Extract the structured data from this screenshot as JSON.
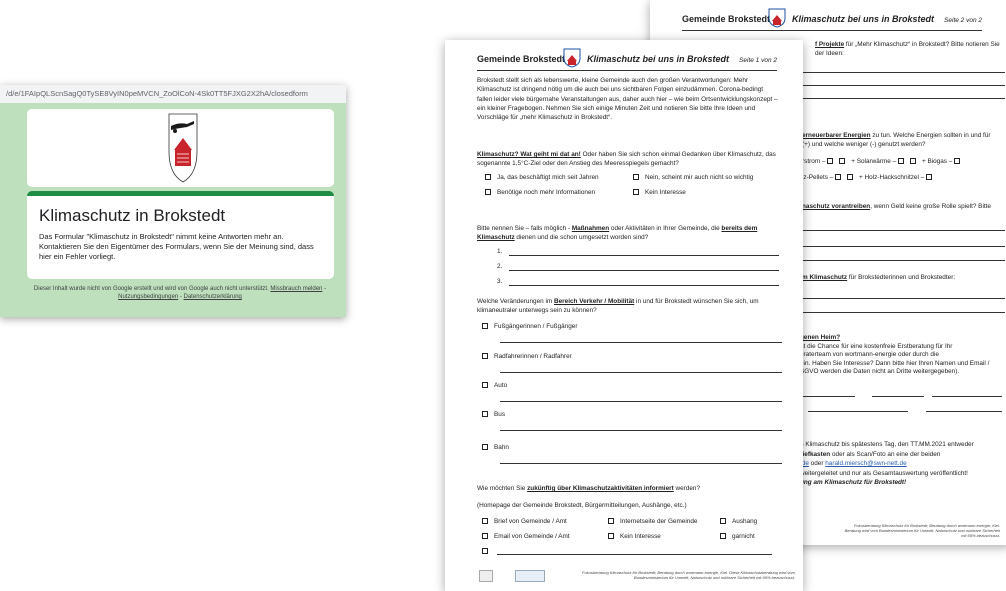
{
  "gform": {
    "url": "/d/e/1FAIpQLScnSagQ0TySE8VyIN0peMVCN_ZoOlCoN-4Sk0TT5FJXG2X2hA/closedform",
    "title": "Klimaschutz in Brokstedt",
    "message": "Das Formular \"Klimaschutz in Brokstedt\" nimmt keine Antworten mehr an. Kontaktieren Sie den Eigentümer des Formulars, wenn Sie der Meinung sind, dass hier ein Fehler vorliegt.",
    "footer_text": "Dieser Inhalt wurde nicht von Google erstellt und wird von Google auch nicht unterstützt.",
    "footer_links": [
      "Missbrauch melden",
      "Nutzungsbedingungen",
      "Datenschutzerklärung"
    ]
  },
  "doc": {
    "municipality": "Gemeinde Brokstedt",
    "subtitle": "Klimaschutz bei uns in Brokstedt",
    "page1_label": "Seite 1 von 2",
    "page2_label": "Seite 2 von 2"
  },
  "page1": {
    "intro": "Brokstedt stellt sich als lebenswerte, kleine Gemeinde auch den großen Verantwortungen: Mehr Klimaschutz ist dringend nötig um die auch bei uns sichtbaren Folgen einzudämmen. Corona-bedingt fallen leider viele bürgernahe Veranstaltungen aus, daher auch hier – wie beim Ortsentwicklungskonzept – ein kleiner Fragebogen. Nehmen Sie sich einige Minuten Zeit und notieren Sie bitte Ihre Ideen und Vorschläge für „mehr Klimaschutz in Brokstedt“.",
    "q1_head": "Klimaschutz? Wat geiht mi dat an!",
    "q1_rest": " Oder haben Sie sich schon einmal Gedanken über Klimaschutz, das sogenannte 1,5°C-Ziel oder den Anstieg des Meeresspiegels gemacht?",
    "q1_options": [
      "Ja, das beschäftigt mich seit Jahren",
      "Nein, scheint mir auch nicht so wichtig",
      "Benötige noch mehr Informationen",
      "Kein Interesse"
    ],
    "q2_a": "Bitte nennen Sie – falls möglich - ",
    "q2_b": "Maßnahmen",
    "q2_c": " oder Aktivitäten in Ihrer Gemeinde, die ",
    "q2_d": "bereits dem Klimaschutz",
    "q2_e": " dienen und die schon umgesetzt worden sind?",
    "q2_numbers": [
      "1.",
      "2.",
      "3."
    ],
    "q3_a": "Welche Veränderungen im ",
    "q3_b": "Bereich Verkehr / Mobilität",
    "q3_c": " in und für Brokstedt wünschen Sie sich, um klimaneutraler unterwegs sein zu können?",
    "q3_options": [
      "Fußgängerinnen / Fußgänger",
      "Radfahrerinnen / Radfahrer",
      "Auto",
      "Bus",
      "Bahn"
    ],
    "q4_a": "Wie möchten Sie ",
    "q4_b": "zukünftig über Klimaschutzaktivitäten informiert",
    "q4_c": " werden?",
    "q4_sub": "(Homepage der Gemeinde Brokstedt, Bürgermitteilungen, Aushänge, etc.)",
    "q4_options": [
      "Brief von Gemeinde / Amt",
      "Internetseite der Gemeinde",
      "Aushang",
      "Email von Gemeinde / Amt",
      "Kein Interesse",
      "garnicht"
    ],
    "footnote": "Fokusberatung Klimaschutz für Brokstedt; Beratung durch wortmann-energie, Kiel. Diese Klimaschutzberatung wird vom Bundesministerium für Umwelt, Naturschutz und nukleare Sicherheit mit 65% bezuschusst."
  },
  "page2": {
    "p_a": "f Projekte",
    "p_b": " für „Mehr Klimaschutz“ in Brokstedt? Bitte notieren Sie",
    "p_c": "der Ideen:",
    "e_a": "erneuerbarer Energien",
    "e_b": " zu tun. Welche Energien sollten in und für",
    "e_c": "(+) und welche weniger (-) genutzt werden?",
    "e_row1_a": "rstrom –",
    "e_row1_b": "+ Solarwärme –",
    "e_row1_c": "+ Biogas –",
    "e_row2_a": "lz-Pellets –",
    "e_row2_b": "+ Holz-Hackschnitzel –",
    "v_a": "naschutz vorantreiben",
    "v_b": ", wenn Geld keine große Rolle spielt? Bitte",
    "k_a": "m Klimaschutz",
    "k_b": " für Brokstedterinnen und Brokstedter:",
    "h_title": "genen Heim?",
    "h_1": "ht die Chance für eine kostenfreie Erstberatung für Ihr",
    "h_2": "eraterteam von wortmann-energie oder durch die",
    "h_3": "ein. Haben Sie Interesse? Dann bitte hier Ihren Namen und Email /",
    "h_4": "SGVO werden die Daten nicht an Dritte weitergegeben).",
    "r_1": "n Klimaschutz bis spätestens Tag, den TT.MM.2021 entweder",
    "r_2": "riefkasten",
    "r_2b": " oder als Scan/Foto an eine der beiden",
    "r_3a": ".de",
    "r_3b": " oder ",
    "r_3c": "harald.miersch@swn-nett.de",
    "r_4": " weitergeleitet und nur als Gesamtauswertung veröffentlicht!",
    "r_5": "ung am Klimaschutz für Brokstedt!",
    "footnote": "Fokusberatung Klimaschutz für Brokstedt; Beratung durch wortmann-energie, Kiel. Beratung wird vom Bundesministerium für Umwelt, Naturschutz und nukleare Sicherheit mit 65% bezuschusst."
  },
  "colors": {
    "form_bg": "#bfe0bd",
    "form_accent": "#1f8c46",
    "crest_red": "#c9242b",
    "crest_blue": "#1b4fa0"
  }
}
